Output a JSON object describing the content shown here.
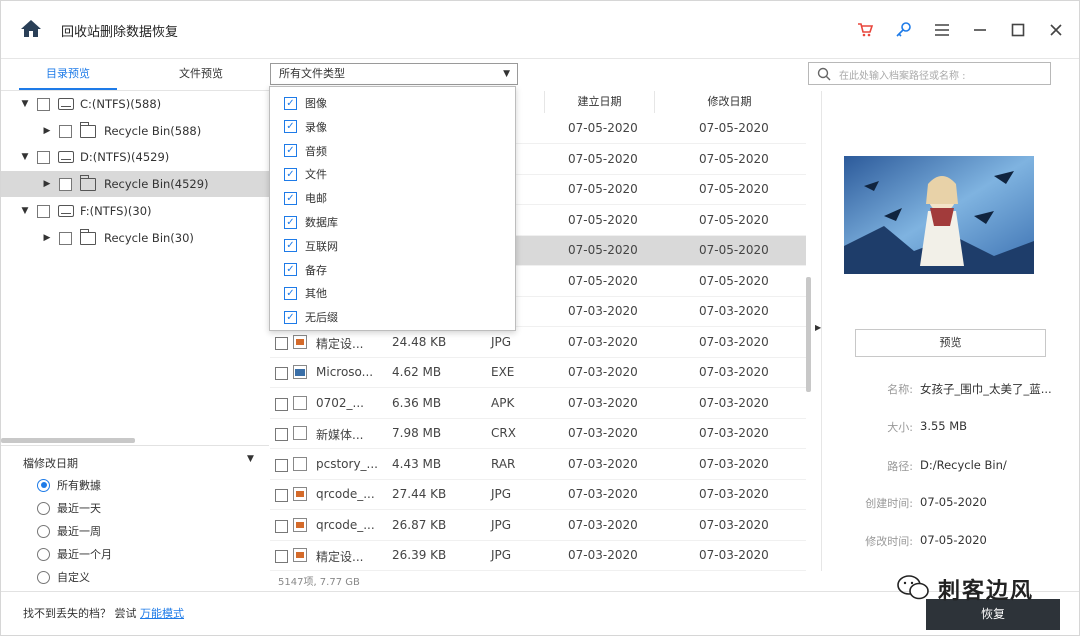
{
  "titlebar": {
    "title": "回收站删除数据恢复"
  },
  "tabs": [
    {
      "label": "目录预览",
      "active": true
    },
    {
      "label": "文件预览",
      "active": false
    }
  ],
  "tree": [
    {
      "label": "C:(NTFS)(588)",
      "type": "drive",
      "level": 0,
      "expanded": true,
      "selected": false
    },
    {
      "label": "Recycle Bin(588)",
      "type": "folder",
      "level": 1,
      "expanded": false,
      "selected": false
    },
    {
      "label": "D:(NTFS)(4529)",
      "type": "drive",
      "level": 0,
      "expanded": true,
      "selected": false
    },
    {
      "label": "Recycle Bin(4529)",
      "type": "folder",
      "level": 1,
      "expanded": false,
      "selected": true
    },
    {
      "label": "F:(NTFS)(30)",
      "type": "drive",
      "level": 0,
      "expanded": true,
      "selected": false
    },
    {
      "label": "Recycle Bin(30)",
      "type": "folder",
      "level": 1,
      "expanded": false,
      "selected": false
    }
  ],
  "filter": {
    "title": "檔修改日期",
    "options": [
      {
        "label": "所有數據",
        "checked": true
      },
      {
        "label": "最近一天",
        "checked": false
      },
      {
        "label": "最近一周",
        "checked": false
      },
      {
        "label": "最近一个月",
        "checked": false
      },
      {
        "label": "自定义",
        "checked": false
      }
    ]
  },
  "type_select": {
    "value": "所有文件类型"
  },
  "dropdown": {
    "items": [
      "图像",
      "录像",
      "音频",
      "文件",
      "电邮",
      "数据库",
      "互联网",
      "备存",
      "其他",
      "无后缀"
    ]
  },
  "search": {
    "placeholder": "在此处输入档案路径或名称 :"
  },
  "table": {
    "headers": [
      "建立日期",
      "修改日期"
    ],
    "rows": [
      {
        "name": "",
        "size": "",
        "type": "",
        "created": "07-05-2020",
        "modified": "07-05-2020",
        "icon": "none",
        "selected": false
      },
      {
        "name": "",
        "size": "",
        "type": "",
        "created": "07-05-2020",
        "modified": "07-05-2020",
        "icon": "none",
        "selected": false
      },
      {
        "name": "",
        "size": "",
        "type": "",
        "created": "07-05-2020",
        "modified": "07-05-2020",
        "icon": "none",
        "selected": false
      },
      {
        "name": "",
        "size": "",
        "type": "",
        "created": "07-05-2020",
        "modified": "07-05-2020",
        "icon": "none",
        "selected": false
      },
      {
        "name": "",
        "size": "",
        "type": "",
        "created": "07-05-2020",
        "modified": "07-05-2020",
        "icon": "none",
        "selected": true
      },
      {
        "name": "",
        "size": "",
        "type": "",
        "created": "07-05-2020",
        "modified": "07-05-2020",
        "icon": "none",
        "selected": false
      },
      {
        "name": "",
        "size": "",
        "type": "",
        "created": "07-03-2020",
        "modified": "07-03-2020",
        "icon": "none",
        "selected": false
      },
      {
        "name": "精定设...",
        "size": "24.48 KB",
        "type": "JPG",
        "created": "07-03-2020",
        "modified": "07-03-2020",
        "icon": "img",
        "selected": false
      },
      {
        "name": "Microso...",
        "size": "4.62 MB",
        "type": "EXE",
        "created": "07-03-2020",
        "modified": "07-03-2020",
        "icon": "exe",
        "selected": false
      },
      {
        "name": "0702_...",
        "size": "6.36 MB",
        "type": "APK",
        "created": "07-03-2020",
        "modified": "07-03-2020",
        "icon": "doc",
        "selected": false
      },
      {
        "name": "新媒体...",
        "size": "7.98 MB",
        "type": "CRX",
        "created": "07-03-2020",
        "modified": "07-03-2020",
        "icon": "doc",
        "selected": false
      },
      {
        "name": "pcstory_...",
        "size": "4.43 MB",
        "type": "RAR",
        "created": "07-03-2020",
        "modified": "07-03-2020",
        "icon": "doc",
        "selected": false
      },
      {
        "name": "qrcode_...",
        "size": "27.44 KB",
        "type": "JPG",
        "created": "07-03-2020",
        "modified": "07-03-2020",
        "icon": "img",
        "selected": false
      },
      {
        "name": "qrcode_...",
        "size": "26.87 KB",
        "type": "JPG",
        "created": "07-03-2020",
        "modified": "07-03-2020",
        "icon": "img",
        "selected": false
      },
      {
        "name": "精定设...",
        "size": "26.39 KB",
        "type": "JPG",
        "created": "07-03-2020",
        "modified": "07-03-2020",
        "icon": "img",
        "selected": false
      }
    ]
  },
  "status": {
    "text": "5147项, 7.77  GB"
  },
  "preview": {
    "button_label": "预览",
    "info": [
      {
        "label": "名称:",
        "value": "女孩子_围巾_太美了_蓝..."
      },
      {
        "label": "大小:",
        "value": "3.55  MB"
      },
      {
        "label": "路径:",
        "value": "D:/Recycle Bin/"
      },
      {
        "label": "创建时间:",
        "value": "07-05-2020"
      },
      {
        "label": "修改时间:",
        "value": "07-05-2020"
      }
    ]
  },
  "bottom": {
    "hint_prefix": "找不到丢失的档？ 尝试 ",
    "hint_link": "万能模式",
    "recover_label": "恢复"
  },
  "watermark": {
    "text": "刺客边风"
  },
  "colors": {
    "accent": "#1e7be8",
    "recover_button": "#2d3339",
    "cart": "#e8463c"
  }
}
